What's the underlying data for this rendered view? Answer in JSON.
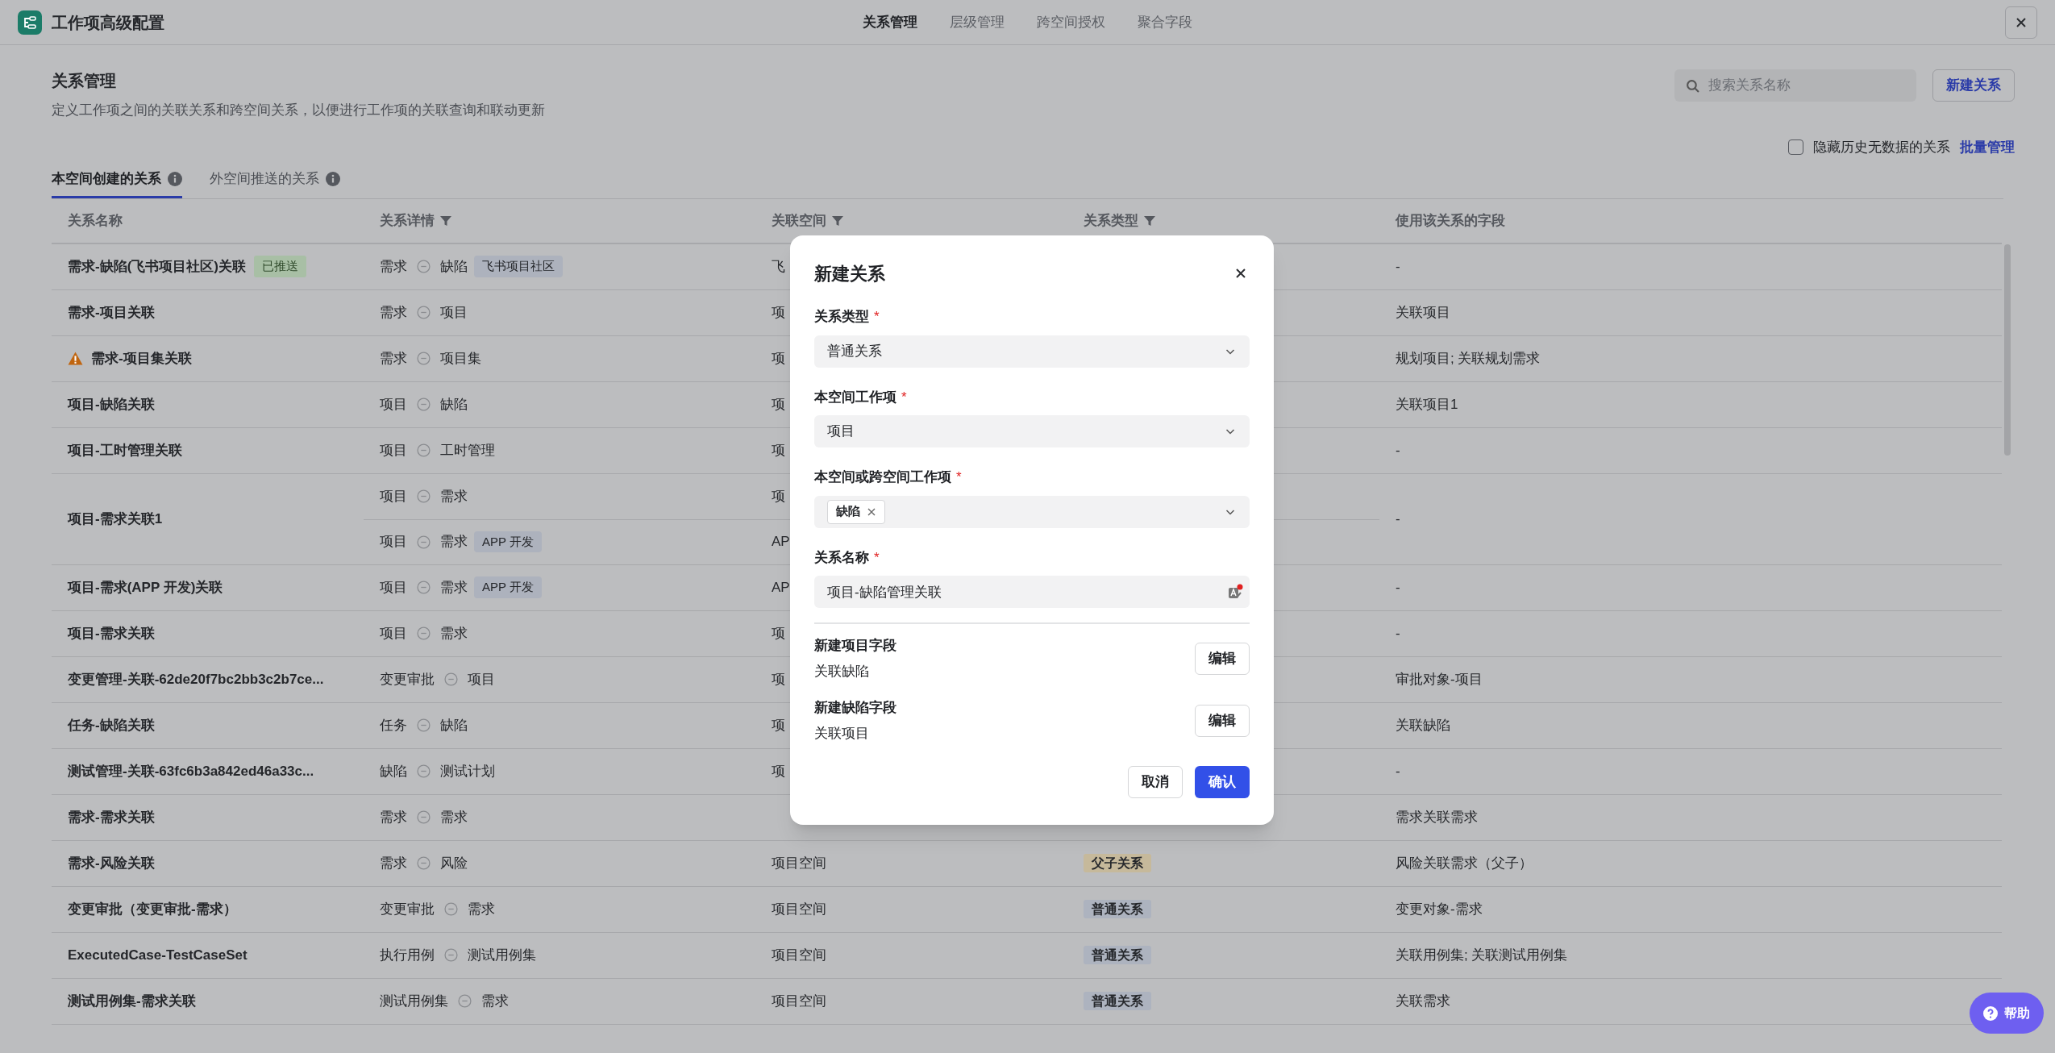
{
  "window": {
    "title": "工作项高级配置"
  },
  "nav_tabs": [
    {
      "label": "关系管理",
      "selected": true
    },
    {
      "label": "层级管理",
      "selected": false
    },
    {
      "label": "跨空间授权",
      "selected": false
    },
    {
      "label": "聚合字段",
      "selected": false
    }
  ],
  "page": {
    "title": "关系管理",
    "description": "定义工作项之间的关联关系和跨空间关系，以便进行工作项的关联查询和联动更新"
  },
  "search": {
    "placeholder": "搜索关系名称"
  },
  "new_button": "新建关系",
  "hide_empty": {
    "label": "隐藏历史无数据的关系",
    "checked": false
  },
  "batch_link": "批量管理",
  "tabs": [
    {
      "label": "本空间创建的关系",
      "selected": true
    },
    {
      "label": "外空间推送的关系",
      "selected": false
    }
  ],
  "table": {
    "columns": [
      {
        "label": "关系名称",
        "filter": false
      },
      {
        "label": "关系详情",
        "filter": true
      },
      {
        "label": "关联空间",
        "filter": true
      },
      {
        "label": "关系类型",
        "filter": true
      },
      {
        "label": "使用该关系的字段",
        "filter": false
      }
    ],
    "rows": [
      {
        "name": "需求-缺陷(飞书项目社区)关联",
        "warning": false,
        "badge": "已推送",
        "links": [
          {
            "from": "需求",
            "to": "缺陷",
            "tag": "飞书项目社区",
            "space": "飞"
          }
        ],
        "fields": "-"
      },
      {
        "name": "需求-项目关联",
        "warning": false,
        "links": [
          {
            "from": "需求",
            "to": "项目",
            "space": "项"
          }
        ],
        "fields": "关联项目"
      },
      {
        "name": "需求-项目集关联",
        "warning": true,
        "links": [
          {
            "from": "需求",
            "to": "项目集",
            "space": "项"
          }
        ],
        "fields": "规划项目; 关联规划需求"
      },
      {
        "name": "项目-缺陷关联",
        "warning": false,
        "links": [
          {
            "from": "项目",
            "to": "缺陷",
            "space": "项"
          }
        ],
        "fields": "关联项目1"
      },
      {
        "name": "项目-工时管理关联",
        "warning": false,
        "links": [
          {
            "from": "项目",
            "to": "工时管理",
            "space": "项"
          }
        ],
        "fields": "-"
      },
      {
        "name": "项目-需求关联1",
        "warning": false,
        "links": [
          {
            "from": "项目",
            "to": "需求",
            "space": "项"
          },
          {
            "from": "项目",
            "to": "需求",
            "tag": "APP 开发",
            "space": "AP"
          }
        ],
        "fields": "-"
      },
      {
        "name": "项目-需求(APP 开发)关联",
        "warning": false,
        "links": [
          {
            "from": "项目",
            "to": "需求",
            "tag": "APP 开发",
            "space": "AP"
          }
        ],
        "fields": "-"
      },
      {
        "name": "项目-需求关联",
        "warning": false,
        "links": [
          {
            "from": "项目",
            "to": "需求",
            "space": "项"
          }
        ],
        "fields": "-"
      },
      {
        "name": "变更管理-关联-62de20f7bc2bb3c2b7ce...",
        "warning": false,
        "links": [
          {
            "from": "变更审批",
            "to": "项目",
            "space": "项"
          }
        ],
        "fields": "审批对象-项目"
      },
      {
        "name": "任务-缺陷关联",
        "warning": false,
        "links": [
          {
            "from": "任务",
            "to": "缺陷",
            "space": "项"
          }
        ],
        "fields": "关联缺陷"
      },
      {
        "name": "测试管理-关联-63fc6b3a842ed46a33c...",
        "warning": false,
        "links": [
          {
            "from": "缺陷",
            "to": "测试计划",
            "space": "项"
          }
        ],
        "fields": "-"
      },
      {
        "name": "需求-需求关联",
        "warning": false,
        "links": [
          {
            "from": "需求",
            "to": "需求"
          }
        ],
        "fields": "需求关联需求"
      },
      {
        "name": "需求-风险关联",
        "warning": false,
        "links": [
          {
            "from": "需求",
            "to": "风险",
            "space": "项目空间",
            "type": {
              "label": "父子关系",
              "color": "#c6b99b"
            }
          }
        ],
        "fields": "风险关联需求（父子）"
      },
      {
        "name": "变更审批（变更审批-需求）",
        "warning": false,
        "links": [
          {
            "from": "变更审批",
            "to": "需求",
            "space": "项目空间",
            "type": {
              "label": "普通关系",
              "color": "#adb3bf"
            }
          }
        ],
        "fields": "变更对象-需求"
      },
      {
        "name": "ExecutedCase-TestCaseSet",
        "warning": false,
        "links": [
          {
            "from": "执行用例",
            "to": "测试用例集",
            "space": "项目空间",
            "type": {
              "label": "普通关系",
              "color": "#adb3bf"
            }
          }
        ],
        "fields": "关联用例集; 关联测试用例集"
      },
      {
        "name": "测试用例集-需求关联",
        "warning": false,
        "links": [
          {
            "from": "测试用例集",
            "to": "需求",
            "space": "项目空间",
            "type": {
              "label": "普通关系",
              "color": "#adb3bf"
            }
          }
        ],
        "fields": "关联需求"
      }
    ]
  },
  "modal": {
    "title": "新建关系",
    "fields": [
      {
        "kind": "select",
        "label": "关系类型",
        "required_mark": "*",
        "value": "普通关系"
      },
      {
        "kind": "select",
        "label": "本空间工作项",
        "required_mark": "*",
        "value": "项目"
      },
      {
        "kind": "tags",
        "label": "本空间或跨空间工作项",
        "required_mark": "*",
        "tags": [
          "缺陷"
        ]
      },
      {
        "kind": "text",
        "label": "关系名称",
        "required_mark": "*",
        "value": "项目-缺陷管理关联"
      }
    ],
    "sections": [
      {
        "title": "新建项目字段",
        "value": "关联缺陷",
        "button": "编辑"
      },
      {
        "title": "新建缺陷字段",
        "value": "关联项目",
        "button": "编辑"
      }
    ],
    "buttons": [
      {
        "label": "取消",
        "primary": false
      },
      {
        "label": "确认",
        "primary": true
      }
    ]
  },
  "help": "帮助"
}
